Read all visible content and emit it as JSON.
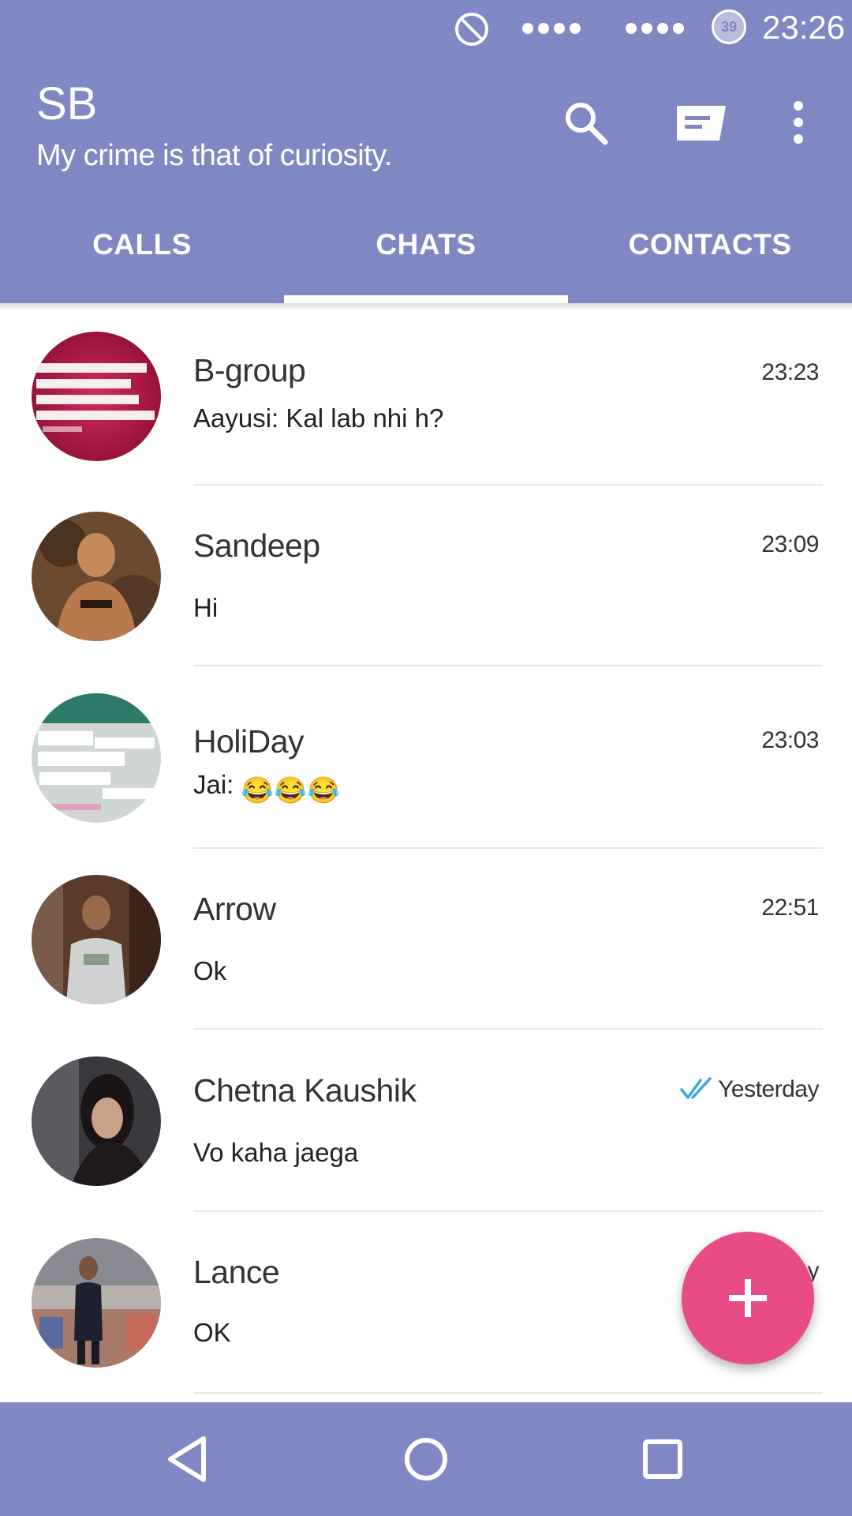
{
  "status_bar": {
    "time": "23:26",
    "battery_level": "39",
    "icons": [
      "do-not-disturb-icon",
      "signal-dots-icon",
      "signal-dots-icon",
      "battery-icon"
    ]
  },
  "header": {
    "title": "SB",
    "subtitle": "My crime is that of curiosity.",
    "actions": [
      "search-icon",
      "compose-icon",
      "more-vert-icon"
    ]
  },
  "tabs": [
    {
      "label": "CALLS",
      "selected": false
    },
    {
      "label": "CHATS",
      "selected": true
    },
    {
      "label": "CONTACTS",
      "selected": false
    }
  ],
  "chats": [
    {
      "name": "B-group",
      "message": "Aayusi: Kal lab nhi h?",
      "time": "23:23"
    },
    {
      "name": "Sandeep",
      "message": "Hi",
      "time": "23:09"
    },
    {
      "name": "HoliDay",
      "message": "Jai:",
      "time": "23:03",
      "emojis": [
        "😂",
        "😂",
        "😂"
      ]
    },
    {
      "name": "Arrow",
      "message": "Ok",
      "time": "22:51"
    },
    {
      "name": "Chetna Kaushik",
      "message": "Vo kaha jaega",
      "time": "Yesterday",
      "read_receipt": "double-check-icon"
    },
    {
      "name": "Lance",
      "message": "OK",
      "time": "Yesterday"
    }
  ],
  "fab": {
    "icon": "plus-icon"
  },
  "colors": {
    "primary": "#7f88c3",
    "accent": "#e84c86",
    "read_receipt": "#3ba9e0"
  },
  "navbar": {
    "icons": [
      "back-icon",
      "home-icon",
      "recents-icon"
    ]
  }
}
